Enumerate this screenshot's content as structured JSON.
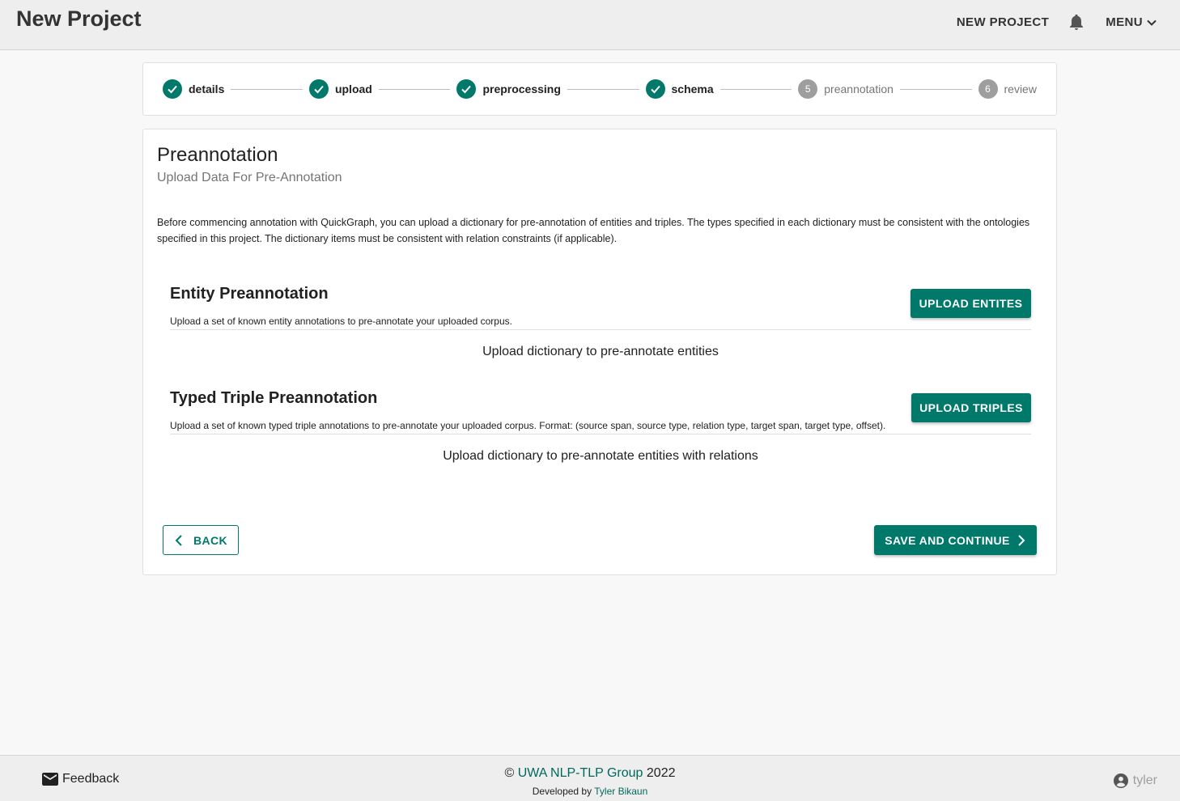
{
  "header": {
    "title": "New Project",
    "new_project_label": "NEW PROJECT",
    "menu_label": "MENU"
  },
  "stepper": {
    "steps": [
      {
        "label": "details",
        "status": "done"
      },
      {
        "label": "upload",
        "status": "done"
      },
      {
        "label": "preprocessing",
        "status": "done"
      },
      {
        "label": "schema",
        "status": "done"
      },
      {
        "label": "preannotation",
        "number": "5",
        "status": "todo"
      },
      {
        "label": "review",
        "number": "6",
        "status": "todo"
      }
    ]
  },
  "main": {
    "title": "Preannotation",
    "subtitle": "Upload Data For Pre-Annotation",
    "description": "Before commencing annotation with QuickGraph, you can upload a dictionary for pre-annotation of entities and triples. The types specified in each dictionary must be consistent with the ontologies specified in this project. The dictionary items must be consistent with relation constraints (if applicable).",
    "entity": {
      "title": "Entity Preannotation",
      "subtitle": "Upload a set of known entity annotations to pre-annotate your uploaded corpus.",
      "button": "UPLOAD ENTITES",
      "empty": "Upload dictionary to pre-annotate entities"
    },
    "triple": {
      "title": "Typed Triple Preannotation",
      "subtitle": "Upload a set of known typed triple annotations to pre-annotate your uploaded corpus. Format: (source span, source type, relation type, target span, target type, offset).",
      "button": "UPLOAD TRIPLES",
      "empty": "Upload dictionary to pre-annotate entities with relations"
    },
    "back_label": "BACK",
    "save_label": "SAVE AND CONTINUE"
  },
  "footer": {
    "feedback": "Feedback",
    "copyright_symbol": "©",
    "copyright_org": "UWA NLP-TLP Group",
    "copyright_year": "2022",
    "developed_by": "Developed by",
    "author": "Tyler Bikaun",
    "user": "tyler"
  },
  "colors": {
    "accent": "#00796b",
    "pending": "#9e9e9e"
  }
}
